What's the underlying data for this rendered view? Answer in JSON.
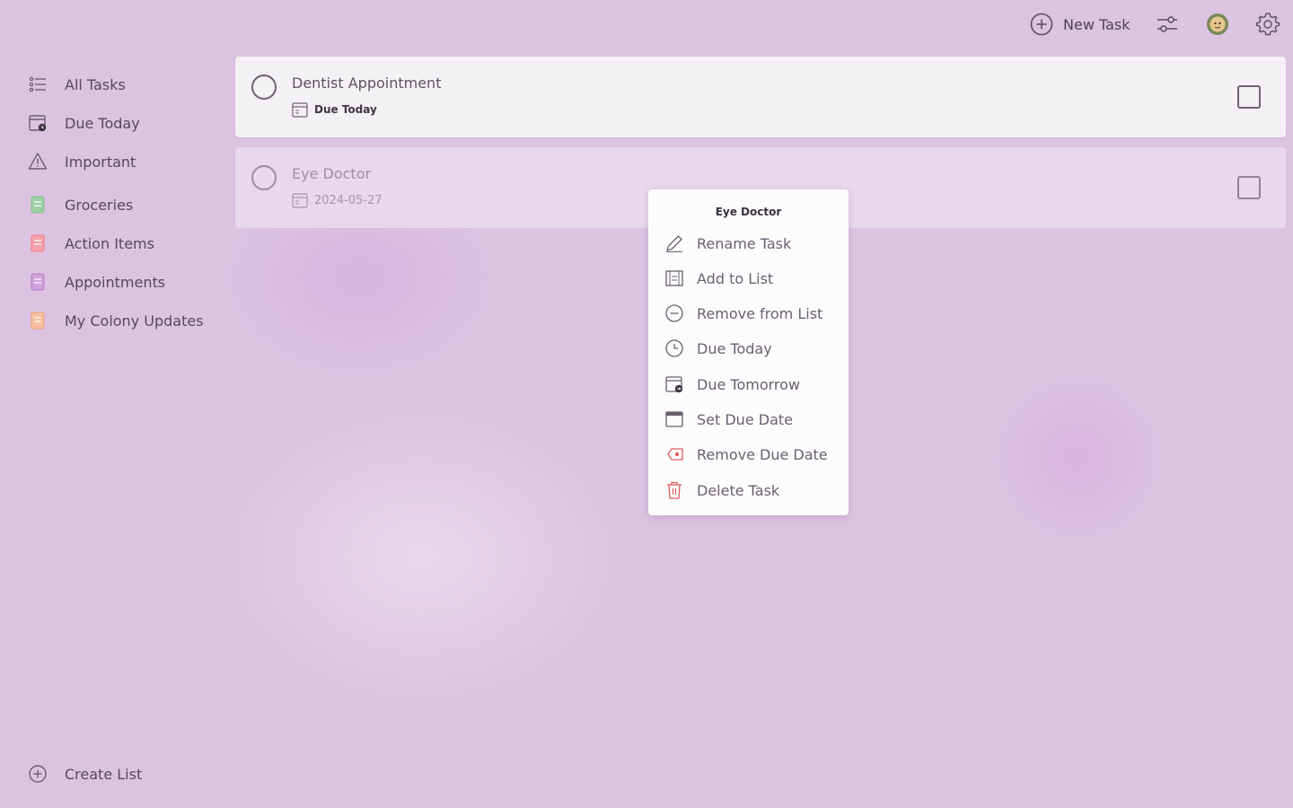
{
  "header": {
    "new_task_label": "New Task",
    "icons": [
      "plus-circle-icon",
      "filter-sliders-icon",
      "avatar",
      "gear-icon"
    ]
  },
  "sidebar": {
    "items": [
      {
        "label": "All Tasks",
        "icon": "list-icon"
      },
      {
        "label": "Due Today",
        "icon": "calendar-today-icon"
      },
      {
        "label": "Important",
        "icon": "warning-icon"
      },
      {
        "label": "Groceries",
        "icon": "list-green-icon",
        "color": "#7fbf86"
      },
      {
        "label": "Action Items",
        "icon": "list-red-icon",
        "color": "#ee7a88"
      },
      {
        "label": "Appointments",
        "icon": "list-purple-icon",
        "color": "#b67cc6"
      },
      {
        "label": "My Colony Updates",
        "icon": "list-orange-icon",
        "color": "#f0a37a"
      }
    ],
    "create_list_label": "Create List"
  },
  "tasks": [
    {
      "title": "Dentist Appointment",
      "due": "Due Today"
    },
    {
      "title": "Eye Doctor",
      "due": "2024-05-27"
    }
  ],
  "context_menu": {
    "title": "Eye Doctor",
    "items": [
      {
        "label": "Rename Task",
        "icon": "pencil-icon"
      },
      {
        "label": "Add to List",
        "icon": "list-add-icon"
      },
      {
        "label": "Remove from List",
        "icon": "minus-circle-icon"
      },
      {
        "label": "Due Today",
        "icon": "clock-icon"
      },
      {
        "label": "Due Tomorrow",
        "icon": "calendar-tomorrow-icon"
      },
      {
        "label": "Set Due Date",
        "icon": "calendar-icon"
      },
      {
        "label": "Remove Due Date",
        "icon": "remove-date-icon",
        "color": "#e05a5a"
      },
      {
        "label": "Delete Task",
        "icon": "trash-icon",
        "color": "#e05a5a"
      }
    ]
  },
  "colors": {
    "background": "#ddc3e2",
    "card": "#f4f1f5",
    "danger": "#e05a5a"
  }
}
